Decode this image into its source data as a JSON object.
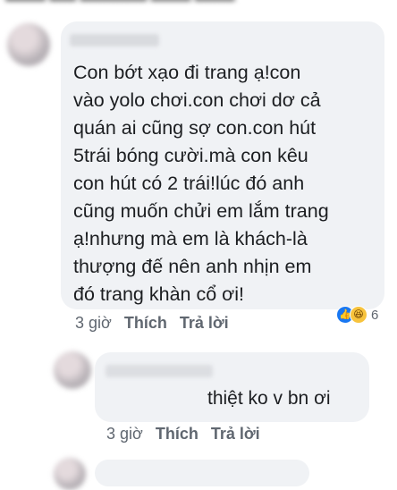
{
  "comment": {
    "text": "Con bớt xạo đi trang ạ!con\nvào yolo chơi.con chơi dơ cả\nquán ai cũng sợ con.con hút\n5trái bóng cười.mà con kêu\ncon hút có 2 trái!lúc đó anh\ncũng muốn chửi em lắm trang\nạ!nhưng mà em là khách-là\nthượng đế nên anh nhịn em\nđó trang khàn cổ ơi!",
    "time": "3 giờ",
    "like_label": "Thích",
    "reply_label": "Trả lời",
    "reaction_count": "6"
  },
  "reply": {
    "text": "thiệt ko v bn ơi",
    "time": "3 giờ",
    "like_label": "Thích",
    "reply_label": "Trả lời"
  }
}
